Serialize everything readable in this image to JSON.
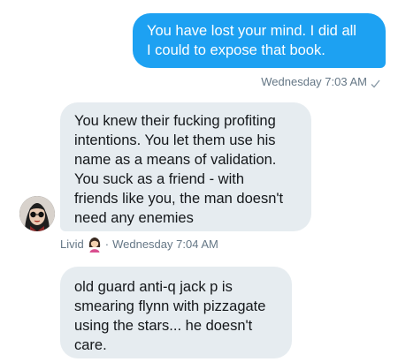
{
  "messages": [
    {
      "direction": "outgoing",
      "lines": [
        "You have lost your mind. I did all",
        "I could to expose that book."
      ],
      "timestamp": "Wednesday 7:03 AM",
      "status_icon": "check-icon"
    },
    {
      "direction": "incoming",
      "lines": [
        "You knew their fucking profiting",
        "intentions. You let them use his",
        "name as a means of validation.",
        "You suck as a friend - with",
        "friends like you, the man doesn't",
        "need any enemies"
      ],
      "sender": "Livid",
      "sender_emoji": "woman-emoji",
      "separator": "·",
      "timestamp": "Wednesday 7:04 AM"
    },
    {
      "direction": "incoming",
      "lines": [
        "old guard anti-q jack p is",
        "smearing flynn with pizzagate",
        "using the stars... he doesn't",
        "care."
      ]
    }
  ],
  "colors": {
    "outgoing_bubble": "#1da1f2",
    "incoming_bubble": "#e6ecf0",
    "meta_text": "#657786"
  }
}
